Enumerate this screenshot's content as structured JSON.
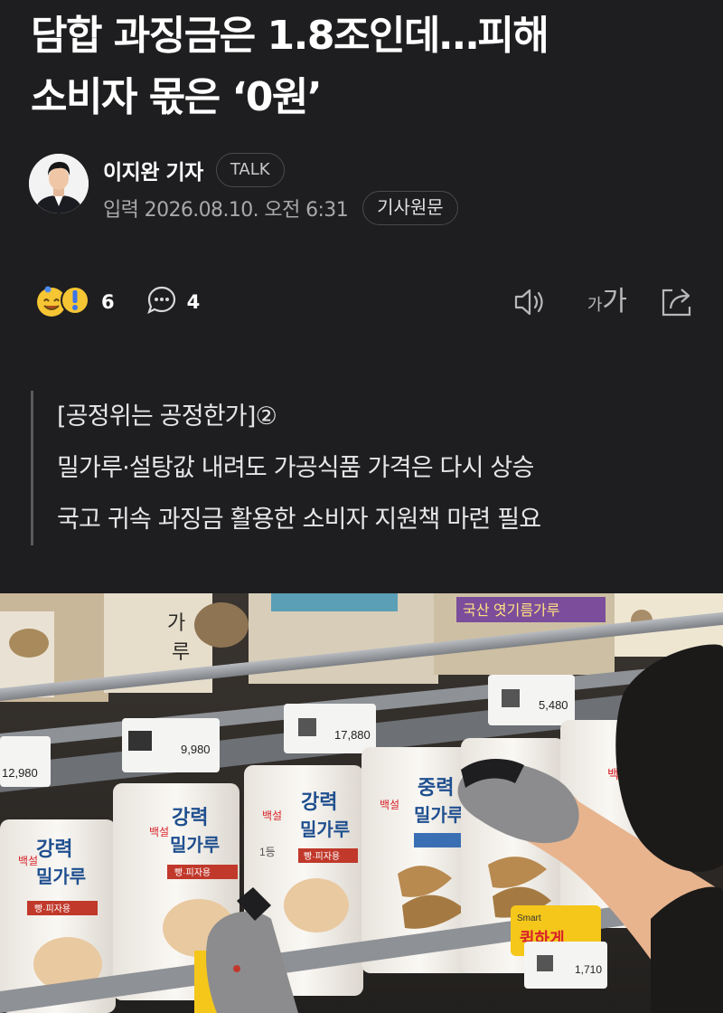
{
  "article": {
    "headline_line1": "담합 과징금은 1.8조인데…피해",
    "headline_line2": "소비자 몫은 ‘0원’",
    "author": {
      "name": "이지완 기자",
      "talk_label": "TALK",
      "date": "입력 2026.08.10. 오전 6:31",
      "original_label": "기사원문"
    },
    "stats": {
      "reactions": "6",
      "comments": "4",
      "font_small": "가",
      "font_large": "가"
    },
    "summary": [
      "[공정위는 공정한가]②",
      "밀가루·설탕값 내려도 가공식품 가격은 다시 상승",
      "국고 귀속 과징금 활용한 소비자 지원책 마련 필요"
    ],
    "photo": {
      "top_bag_1": "가",
      "top_bag_2": "루",
      "top_label_sign": "국산 엿기름가루",
      "prices": [
        "12,980",
        "9,980",
        "17,880",
        "5,480",
        "1,710"
      ],
      "bag_brand": "백설",
      "bag_name_1": "강력",
      "bag_name_2": "밀가루",
      "bag_name_mid": "중력",
      "bag_sub_1": "빵·피자용",
      "bag_grade": "1등",
      "promo_text": "퀵하게",
      "promo_brand": "Smart"
    },
    "colors": {
      "background": "#1e1e20",
      "text": "#ffffff",
      "muted": "#a8a8ac",
      "accent_red": "#d8232a"
    },
    "icons": [
      "emoji-reaction-icon",
      "comment-icon",
      "speaker-icon",
      "font-size-icon",
      "share-icon"
    ]
  }
}
